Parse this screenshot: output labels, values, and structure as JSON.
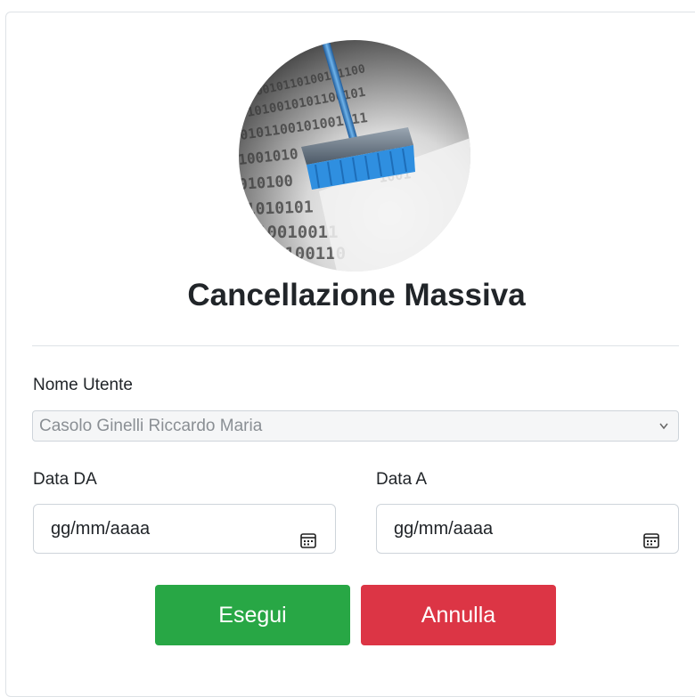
{
  "page": {
    "title": "Cancellazione Massiva"
  },
  "form": {
    "user_label": "Nome Utente",
    "user_value": "Casolo Ginelli Riccardo Maria",
    "date_from_label": "Data DA",
    "date_from_placeholder": "gg/mm/aaaa",
    "date_to_label": "Data A",
    "date_to_placeholder": "gg/mm/aaaa"
  },
  "buttons": {
    "execute_label": "Esegui",
    "cancel_label": "Annulla"
  },
  "icons": {
    "logo": "broom-on-binary-data-image",
    "select_chevron": "chevron-down-icon",
    "date_picker": "calendar-icon"
  },
  "colors": {
    "execute": "#28a745",
    "cancel": "#dc3545"
  }
}
